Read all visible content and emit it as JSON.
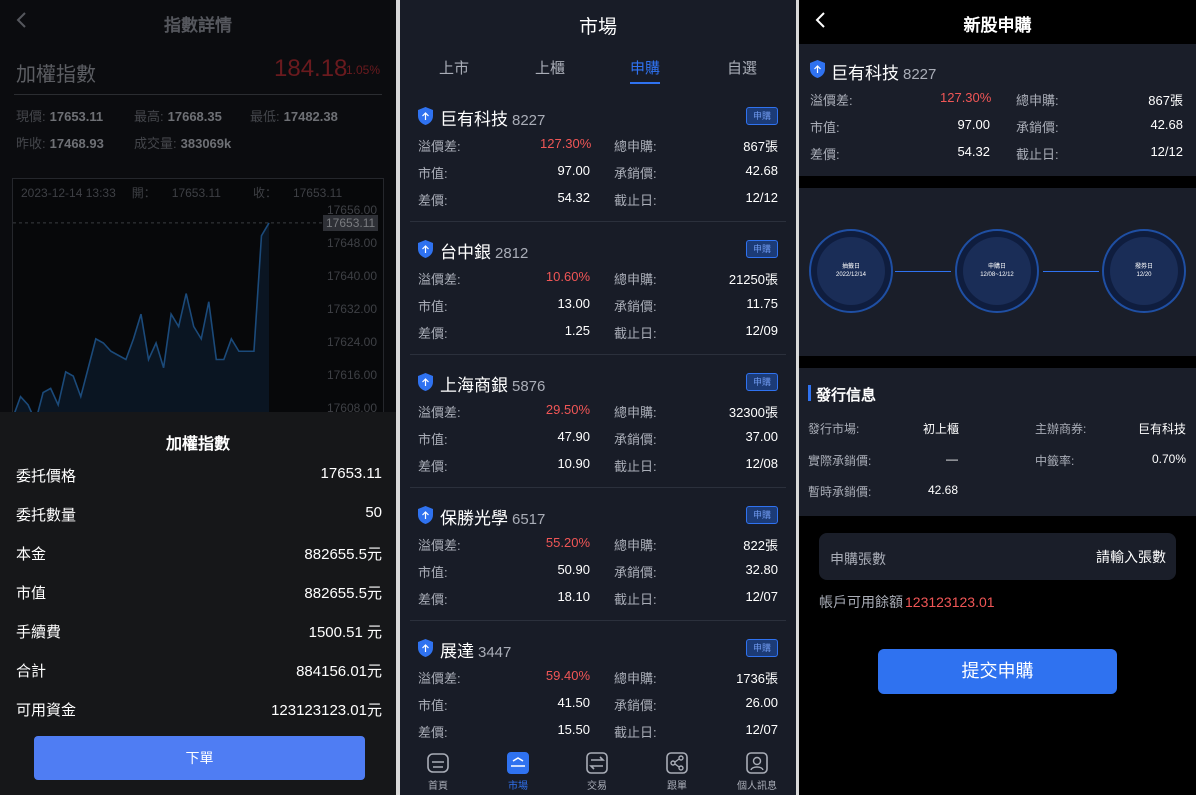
{
  "screen1": {
    "title": "指數詳情",
    "index_name": "加權指數",
    "price": "184.18",
    "change_pct": "1.05%",
    "stats": {
      "now_label": "現價:",
      "now_value": "17653.11",
      "high_label": "最高:",
      "high_value": "17668.35",
      "low_label": "最低:",
      "low_value": "17482.38",
      "prev_label": "昨收:",
      "prev_value": "17468.93",
      "volume_label": "成交量:",
      "volume_value": "383069k"
    },
    "chart_info": {
      "datetime": "2023-12-14 13:33",
      "open_label": "開：",
      "open_value": "17653.11",
      "close_label": "收：",
      "close_value": "17653.11"
    },
    "y_ticks": [
      "17656.00",
      "17648.00",
      "17640.00",
      "17632.00",
      "17624.00",
      "17616.00",
      "17608.00"
    ],
    "current_price_label": "17653.11",
    "line_values": [
      17606,
      17611,
      17609,
      17605,
      17612,
      17613,
      17609,
      17617,
      17616,
      17611,
      17618,
      17625,
      17624,
      17622,
      17621,
      17620,
      17625,
      17631,
      17620,
      17624,
      17618,
      17631,
      17628,
      17636,
      17628,
      17625,
      17634,
      17620,
      17620,
      17625,
      17622,
      17622,
      17622,
      17650,
      17653.11
    ],
    "sheet": {
      "title": "加權指數",
      "rows": [
        {
          "label": "委托價格",
          "value": "17653.11"
        },
        {
          "label": "委托數量",
          "value": "50"
        },
        {
          "label": "本金",
          "value": "882655.5元"
        },
        {
          "label": "市值",
          "value": "882655.5元"
        },
        {
          "label": "手續費",
          "value": "1500.51 元"
        },
        {
          "label": "合計",
          "value": "884156.01元"
        },
        {
          "label": "可用資金",
          "value": "123123123.01元"
        }
      ],
      "order_button": "下單"
    }
  },
  "screen2": {
    "title": "市場",
    "tabs": [
      "上市",
      "上櫃",
      "申購",
      "自選"
    ],
    "active_tab": "申購",
    "apply_tag": "申購",
    "labels": {
      "premium": "溢價差:",
      "total": "總申購:",
      "market": "市值:",
      "underwrite": "承銷價:",
      "diff": "差價:",
      "deadline": "截止日:"
    },
    "cards": [
      {
        "name": "巨有科技",
        "code": "8227",
        "premium": "127.30%",
        "total": "867張",
        "market": "97.00",
        "underwrite": "42.68",
        "diff": "54.32",
        "deadline": "12/12"
      },
      {
        "name": "台中銀",
        "code": "2812",
        "premium": "10.60%",
        "total": "21250張",
        "market": "13.00",
        "underwrite": "11.75",
        "diff": "1.25",
        "deadline": "12/09"
      },
      {
        "name": "上海商銀",
        "code": "5876",
        "premium": "29.50%",
        "total": "32300張",
        "market": "47.90",
        "underwrite": "37.00",
        "diff": "10.90",
        "deadline": "12/08"
      },
      {
        "name": "保勝光學",
        "code": "6517",
        "premium": "55.20%",
        "total": "822張",
        "market": "50.90",
        "underwrite": "32.80",
        "diff": "18.10",
        "deadline": "12/07"
      },
      {
        "name": "展達",
        "code": "3447",
        "premium": "59.40%",
        "total": "1736張",
        "market": "41.50",
        "underwrite": "26.00",
        "diff": "15.50",
        "deadline": "12/07"
      }
    ],
    "nav": [
      {
        "label": "首頁",
        "icon": "home-icon"
      },
      {
        "label": "市場",
        "icon": "market-icon"
      },
      {
        "label": "交易",
        "icon": "trade-icon"
      },
      {
        "label": "跟單",
        "icon": "share-icon"
      },
      {
        "label": "個人訊息",
        "icon": "user-icon"
      }
    ]
  },
  "screen3": {
    "title": "新股申購",
    "stock_name": "巨有科技",
    "stock_code": "8227",
    "rows": [
      {
        "l1": "溢價差:",
        "v1": "127.30%",
        "l2": "總申購:",
        "v2": "867張"
      },
      {
        "l1": "市值:",
        "v1": "97.00",
        "l2": "承銷價:",
        "v2": "42.68"
      },
      {
        "l1": "差價:",
        "v1": "54.32",
        "l2": "截止日:",
        "v2": "12/12"
      }
    ],
    "timeline": [
      {
        "label": "抽籤日",
        "date": "2022/12/14"
      },
      {
        "label": "申購日",
        "date": "12/08~12/12"
      },
      {
        "label": "撥券日",
        "date": "12/20"
      }
    ],
    "issue": {
      "title": "發行信息",
      "market_label": "發行市場:",
      "market_value": "初上櫃",
      "broker_label": "主辦商券:",
      "broker_value": "巨有科技",
      "actual_label": "實際承銷價:",
      "actual_value": "—",
      "rate_label": "中籤率:",
      "rate_value": "0.70%",
      "temp_label": "暫時承銷價:",
      "temp_value": "42.68"
    },
    "qty_label": "申購張數",
    "qty_placeholder": "請輸入張數",
    "balance_label": "帳戶可用餘額",
    "balance_value": "123123123.01",
    "submit": "提交申購"
  },
  "colors": {
    "accent": "#2f72f0",
    "red": "#f05656",
    "panel": "#1a1e29"
  }
}
